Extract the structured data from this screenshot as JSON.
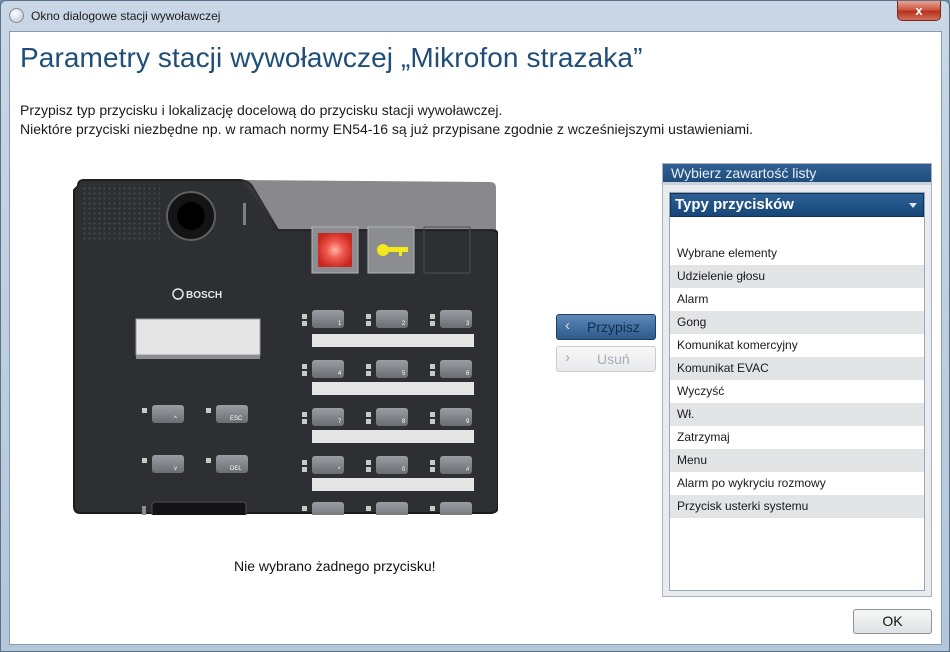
{
  "window": {
    "title": "Okno dialogowe stacji wywoławczej",
    "close_label": "x"
  },
  "content": {
    "heading": "Parametry stacji wywoławczej „Mikrofon strazaka”",
    "desc_line1": "Przypisz typ przycisku i lokalizację docelową do przycisku stacji wywoławczej.",
    "desc_line2": "Niektóre przyciski niezbędne np. w ramach normy EN54-16 są już przypisane zgodnie z wcześniejszymi ustawieniami.",
    "status": "Nie wybrano żadnego przycisku!"
  },
  "device": {
    "brand": "BOSCH",
    "keys": {
      "up": "^",
      "esc": "ESC",
      "down": "v",
      "del": "DEL",
      "k1": "1",
      "k2": "2",
      "k3": "3",
      "k4": "4",
      "k5": "5",
      "k6": "6",
      "k7": "7",
      "k8": "8",
      "k9": "9",
      "star": "*",
      "k0": "0",
      "hash": "#"
    },
    "colors": {
      "body": "#2d2e31",
      "alarm_button": "#e8453c",
      "key_icon": "#f3e81c"
    }
  },
  "actions": {
    "assign_label": "Przypisz",
    "remove_label": "Usuń",
    "assign_icon": "chevron-left-icon",
    "remove_icon": "chevron-right-icon"
  },
  "panel": {
    "header": "Wybierz zawartość listy",
    "dropdown_value": "Typy przycisków",
    "items": [
      "Wybrane elementy",
      "Udzielenie głosu",
      "Alarm",
      "Gong",
      "Komunikat komercyjny",
      "Komunikat EVAC",
      "Wyczyść",
      "Wł.",
      "Zatrzymaj",
      "Menu",
      "Alarm po wykryciu rozmowy",
      "Przycisk usterki systemu"
    ]
  },
  "footer": {
    "ok_label": "OK"
  }
}
